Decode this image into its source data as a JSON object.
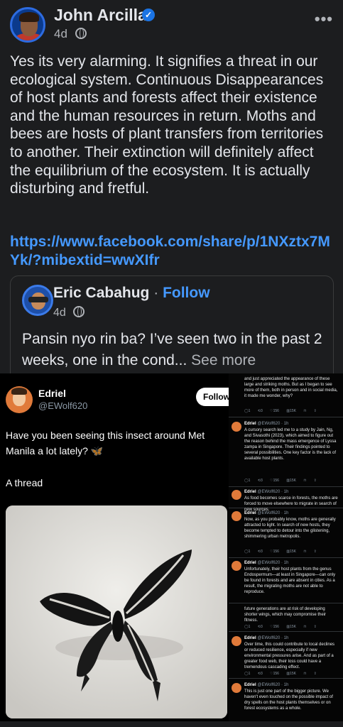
{
  "post": {
    "author": "John Arcilla",
    "time": "4d",
    "more": "•••",
    "verified": "✓",
    "body": "Yes its very alarming. It signifies a threat in our ecological system. Continuous Disappearances of host plants and forests affect their existence and the human resources in return. Moths and bees are hosts of plant transfers from territories to another. Their extinction will definitely affect the equilibrium of the ecosystem. It is actually disturbing and fretful.",
    "link": "https://www.facebook.com/share/p/1NXztx7MYk/?mibextid=wwXIfr"
  },
  "shared": {
    "author": "Eric Cabahug",
    "dot": "·",
    "follow": "Follow",
    "time": "4d",
    "text": "Pansin nyo rin ba? I’ve seen two in the past 2 weeks, one in the cond...",
    "see_more": "See more"
  },
  "tweet": {
    "name": "Edriel",
    "handle": "@EWolf620",
    "follow": "Follow",
    "text_line1": "Have you been seeing this insect around Met",
    "text_line2": "Manila a lot lately?",
    "emoji": "🦋",
    "thread": "A thread"
  },
  "replies": [
    {
      "head_name": "",
      "head_meta": "",
      "text": "and just appreciated the appearance of these large and striking moths. But as I began to see more of them, both in person and in social media, it made me wonder, why?"
    },
    {
      "head_name": "Edriel",
      "head_meta": "@EWolf620 · 1h",
      "text": "A cursory search led me to a study by Jain, Ng, and Sivasothi (2023), which aimed to figure out the reason behind the mass emergence of Lyssa zampa in Singapore. Their findings pointed to several possibilities. One key factor is the lack of available host plants."
    },
    {
      "head_name": "Edriel",
      "head_meta": "@EWolf620 · 1h",
      "text": "As food becomes scarce in forests, the moths are forced to move elsewhere to migrate in search of new sources."
    },
    {
      "head_name": "Edriel",
      "head_meta": "@EWolf620 · 1h",
      "text": "Now, as you probably know, moths are generally attracted to light. In search of new hosts, they become tempted to detour into the glistening, shimmering urban metropolis."
    },
    {
      "head_name": "Edriel",
      "head_meta": "@EWolf620 · 1h",
      "text": "Unfortunately, their host plants from the genus Endospermum—at least in Singapore—can only be found in forests and are absent in cities. As a result, the migrating moths are not able to reproduce."
    },
    {
      "head_name": "",
      "head_meta": "",
      "text": "future generations are at risk of developing shorter wings, which may compromise their fitness."
    },
    {
      "head_name": "Edriel",
      "head_meta": "@EWolf620 · 1h",
      "text": "Over time, this could contribute to local declines or reduced resilience, especially if new environmental pressures arise. And as part of a greater food web, their loss could have a tremendous cascading effect."
    },
    {
      "head_name": "Edriel",
      "head_meta": "@EWolf620 · 1h",
      "text": "This is just one part of the bigger picture. We haven't even touched on the possible impact of dry spells on the host plants themselves or on forest ecosystems as a whole."
    }
  ],
  "reply_actions": "◯1 ⟲3 ♡156 ▥15K ⊓ ⇪",
  "colors": {
    "background": "#1c1d1f",
    "text": "#e4e6eb",
    "secondary_text": "#b0b3b8",
    "link": "#4599ff",
    "verified": "#1b74e4"
  }
}
